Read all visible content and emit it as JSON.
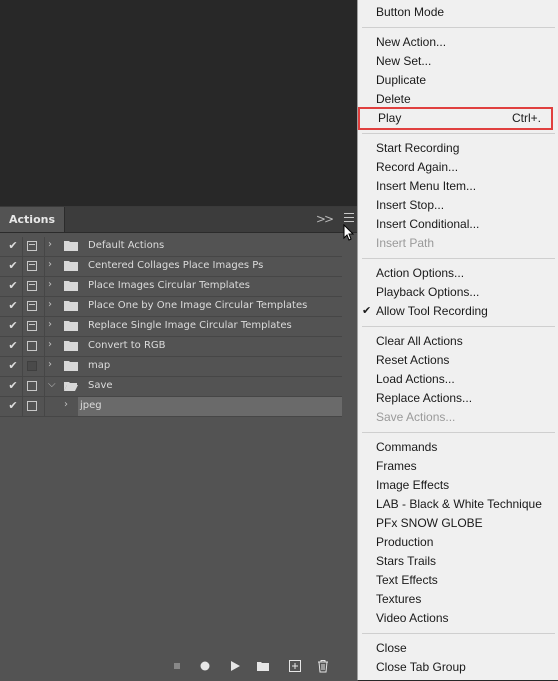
{
  "panel": {
    "tab_label": "Actions",
    "collapse_icon": ">>",
    "menu_icon": "panel-menu-icon",
    "rows": [
      {
        "name": "Default Actions",
        "checked": true,
        "dialog": "shown",
        "expanded": false,
        "type": "set"
      },
      {
        "name": "Centered Collages Place Images Ps",
        "checked": true,
        "dialog": "shown",
        "expanded": false,
        "type": "set"
      },
      {
        "name": "Place Images Circular Templates",
        "checked": true,
        "dialog": "shown",
        "expanded": false,
        "type": "set"
      },
      {
        "name": "Place One by One Image Circular Templates",
        "checked": true,
        "dialog": "shown",
        "expanded": false,
        "type": "set"
      },
      {
        "name": "Replace Single Image Circular Templates",
        "checked": true,
        "dialog": "shown",
        "expanded": false,
        "type": "set"
      },
      {
        "name": "Convert to RGB",
        "checked": true,
        "dialog": "empty",
        "expanded": false,
        "type": "set"
      },
      {
        "name": "map",
        "checked": true,
        "dialog": "hidden",
        "expanded": false,
        "type": "set"
      },
      {
        "name": "Save",
        "checked": true,
        "dialog": "empty",
        "expanded": true,
        "type": "set"
      },
      {
        "name": "jpeg",
        "checked": true,
        "dialog": "empty",
        "expanded": false,
        "type": "action",
        "selected": true
      }
    ],
    "footer_icons": [
      "stop-icon",
      "record-icon",
      "play-icon",
      "new-set-icon",
      "new-action-icon",
      "delete-icon"
    ]
  },
  "menu": {
    "items": [
      {
        "label": "Button Mode"
      },
      {
        "sep": true
      },
      {
        "label": "New Action..."
      },
      {
        "label": "New Set..."
      },
      {
        "label": "Duplicate"
      },
      {
        "label": "Delete"
      },
      {
        "label": "Play",
        "shortcut": "Ctrl+.",
        "highlight": true
      },
      {
        "sep": true
      },
      {
        "label": "Start Recording"
      },
      {
        "label": "Record Again..."
      },
      {
        "label": "Insert Menu Item..."
      },
      {
        "label": "Insert Stop..."
      },
      {
        "label": "Insert Conditional..."
      },
      {
        "label": "Insert Path",
        "disabled": true
      },
      {
        "sep": true
      },
      {
        "label": "Action Options..."
      },
      {
        "label": "Playback Options..."
      },
      {
        "label": "Allow Tool Recording",
        "checked": true
      },
      {
        "sep": true
      },
      {
        "label": "Clear All Actions"
      },
      {
        "label": "Reset Actions"
      },
      {
        "label": "Load Actions..."
      },
      {
        "label": "Replace Actions..."
      },
      {
        "label": "Save Actions...",
        "disabled": true
      },
      {
        "sep": true
      },
      {
        "label": "Commands"
      },
      {
        "label": "Frames"
      },
      {
        "label": "Image Effects"
      },
      {
        "label": "LAB - Black & White Technique"
      },
      {
        "label": "PFx SNOW GLOBE"
      },
      {
        "label": "Production"
      },
      {
        "label": "Stars Trails"
      },
      {
        "label": "Text Effects"
      },
      {
        "label": "Textures"
      },
      {
        "label": "Video Actions"
      },
      {
        "sep": true
      },
      {
        "label": "Close"
      },
      {
        "label": "Close Tab Group"
      }
    ]
  }
}
